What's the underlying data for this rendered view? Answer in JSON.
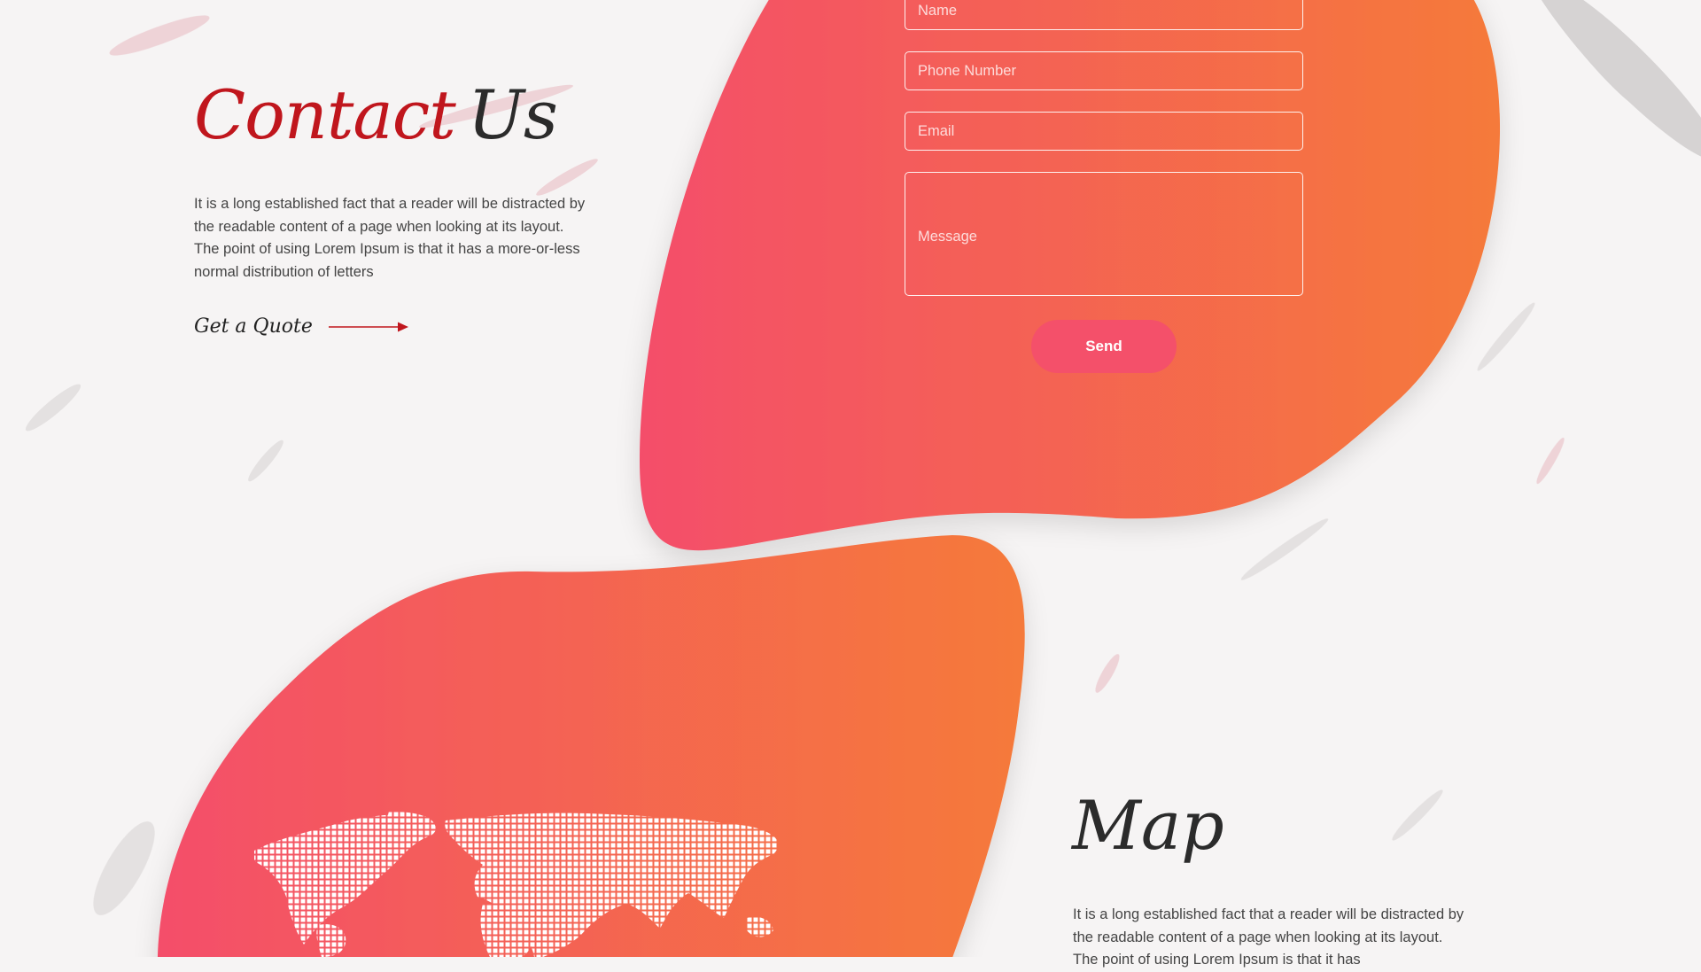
{
  "colors": {
    "background": "#f6f4f4",
    "accent_red": "#c0161d",
    "gradient_start": "#f44e6a",
    "gradient_end": "#f57a3a",
    "send_button": "#f4506a"
  },
  "contact": {
    "title_part1": "Contact",
    "title_part2": "Us",
    "paragraph": "It is a long established fact that a reader will be distracted by the readable content of a page when looking at its layout. The point of using Lorem Ipsum is that it has a more-or-less normal distribution of letters",
    "quote_link": "Get a Quote",
    "arrow_icon": "arrow-right-icon"
  },
  "form": {
    "name_placeholder": "Name",
    "phone_placeholder": "Phone Number",
    "email_placeholder": "Email",
    "message_placeholder": "Message",
    "send_label": "Send"
  },
  "map": {
    "title": "Map",
    "paragraph": "It is a long established fact that a reader will be distracted by the readable content of a page when looking at its layout. The point of using Lorem Ipsum is that it has",
    "map_icon": "world-map-icon"
  }
}
